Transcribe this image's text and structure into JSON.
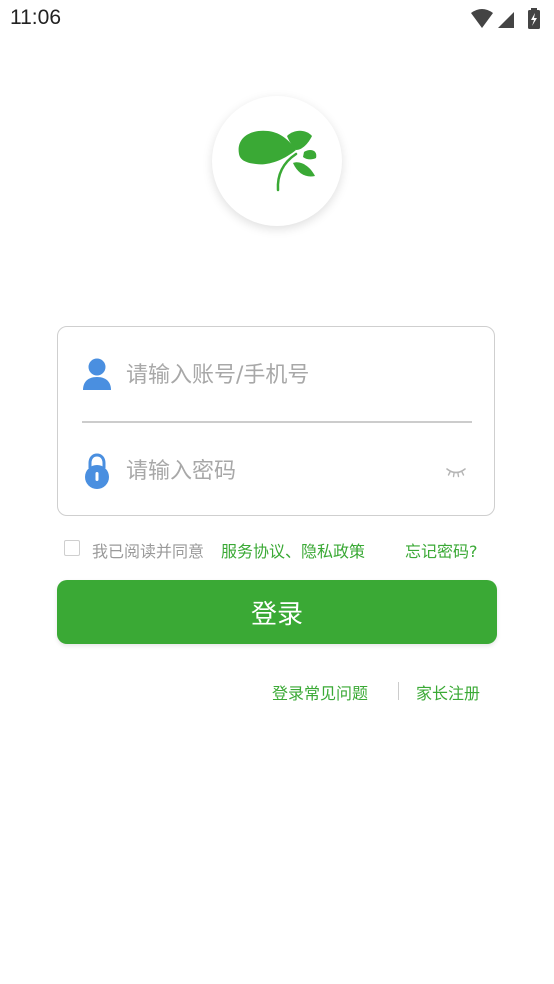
{
  "status_bar": {
    "time": "11:06",
    "icons": [
      "wifi-icon",
      "signal-icon",
      "battery-charging-icon"
    ]
  },
  "logo": {
    "icon": "clover-leaf-icon",
    "color": "#3aa935"
  },
  "login_form": {
    "account": {
      "icon": "user-icon",
      "value": "",
      "placeholder": "请输入账号/手机号"
    },
    "password": {
      "icon": "lock-icon",
      "value": "",
      "placeholder": "请输入密码",
      "toggle_icon": "eye-closed-icon"
    }
  },
  "agreement": {
    "checked": false,
    "text": "我已阅读并同意",
    "link_text": "服务协议、隐私政策",
    "forgot_password": "忘记密码?"
  },
  "login_button": {
    "label": "登录"
  },
  "bottom_links": {
    "faq": "登录常见问题",
    "parent_register": "家长注册"
  },
  "colors": {
    "accent": "#3aa935",
    "icon_blue": "#4a8fe0",
    "placeholder": "#a8a8a8",
    "border": "#cfcfcf"
  }
}
